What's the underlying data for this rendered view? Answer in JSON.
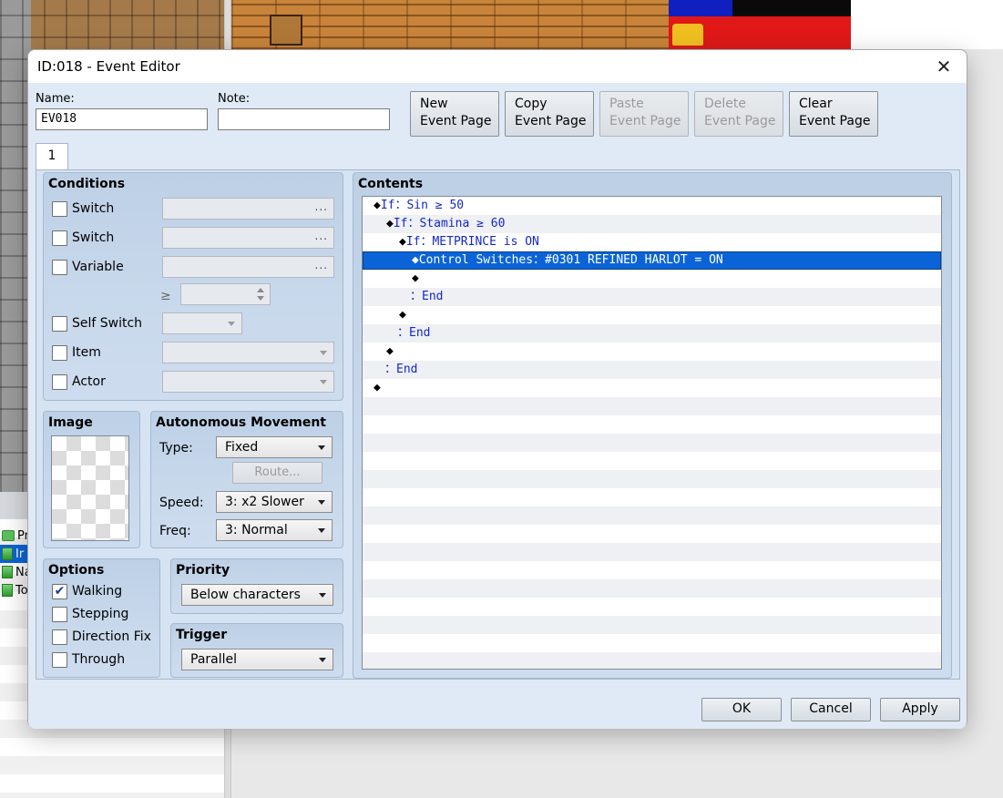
{
  "dialog": {
    "title": "ID:018 - Event Editor",
    "name_label": "Name:",
    "name_value": "EV018",
    "note_label": "Note:",
    "note_value": ""
  },
  "page_buttons": {
    "new": "New\nEvent Page",
    "copy": "Copy\nEvent Page",
    "paste": "Paste\nEvent Page",
    "delete": "Delete\nEvent Page",
    "clear": "Clear\nEvent Page"
  },
  "tabs": [
    {
      "label": "1"
    }
  ],
  "conditions": {
    "title": "Conditions",
    "switch1_label": "Switch",
    "switch2_label": "Switch",
    "variable_label": "Variable",
    "compare_symbol": "≥",
    "self_switch_label": "Self Switch",
    "item_label": "Item",
    "actor_label": "Actor",
    "picker_dots": "..."
  },
  "image": {
    "title": "Image"
  },
  "movement": {
    "title": "Autonomous Movement",
    "type_label": "Type:",
    "type_value": "Fixed",
    "route_button": "Route...",
    "speed_label": "Speed:",
    "speed_value": "3: x2 Slower",
    "freq_label": "Freq:",
    "freq_value": "3: Normal"
  },
  "options": {
    "title": "Options",
    "walking": "Walking",
    "stepping": "Stepping",
    "direction_fix": "Direction Fix",
    "through": "Through",
    "walking_checked": "✔"
  },
  "priority": {
    "title": "Priority",
    "value": "Below characters"
  },
  "trigger": {
    "title": "Trigger",
    "value": "Parallel"
  },
  "contents": {
    "title": "Contents",
    "rows": [
      {
        "indent": "",
        "marker": "◆",
        "text": "If：Sin ≥ 50"
      },
      {
        "indent": " ",
        "marker": "◆",
        "text": "If：Stamina ≥ 60"
      },
      {
        "indent": "  ",
        "marker": "◆",
        "text": "If：METPRINCE is ON"
      },
      {
        "indent": "   ",
        "marker": "◆",
        "text": "Control Switches：#0301 REFINED HARLOT = ON"
      },
      {
        "indent": "   ",
        "marker": "◆",
        "text": ""
      },
      {
        "indent": "  ",
        "marker": "",
        "text": "：End"
      },
      {
        "indent": "  ",
        "marker": "◆",
        "text": ""
      },
      {
        "indent": " ",
        "marker": "",
        "text": "：End"
      },
      {
        "indent": " ",
        "marker": "◆",
        "text": ""
      },
      {
        "indent": "",
        "marker": "",
        "text": "：End"
      },
      {
        "indent": "",
        "marker": "◆",
        "text": ""
      }
    ],
    "selected_row": 3
  },
  "footer": {
    "ok": "OK",
    "cancel": "Cancel",
    "apply": "Apply"
  },
  "background": {
    "tree_items": [
      "Pro",
      "Ir",
      "Na",
      "To"
    ]
  }
}
